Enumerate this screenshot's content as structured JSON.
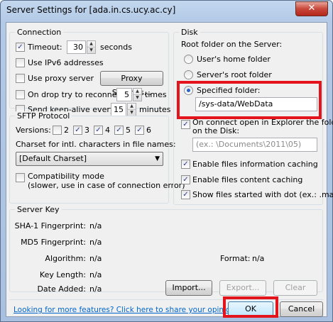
{
  "window": {
    "title": "Server Settings for [ada.in.cs.ucy.ac.cy]",
    "close_glyph": "✕"
  },
  "connection": {
    "title": "Connection",
    "timeout_label": "Timeout:",
    "timeout_value": "30",
    "timeout_unit": "seconds",
    "ipv6_label": "Use IPv6 addresses",
    "proxy_label": "Use proxy server",
    "proxy_button": "Proxy Settings...",
    "reconnect_label": "On drop try to reconnect",
    "reconnect_value": "5",
    "reconnect_unit": "times",
    "keepalive_label": "Send keep-alive every",
    "keepalive_value": "15",
    "keepalive_unit": "minutes"
  },
  "sftp": {
    "title": "SFTP Protocol",
    "versions_label": "Versions:",
    "versions": [
      "2",
      "3",
      "4",
      "5",
      "6"
    ],
    "charset_label": "Charset for intl. characters in file names:",
    "charset_value": "[Default Charset]",
    "compat_line1": "Compatibility mode",
    "compat_line2": "(slower, use in case of connection error)"
  },
  "disk": {
    "title": "Disk",
    "root_label": "Root folder on the Server:",
    "opt_home": "User's home folder",
    "opt_root": "Server's root folder",
    "opt_specified": "Specified folder:",
    "folder_value": "/sys-data/WebData",
    "open_line1": "On connect open in Explorer the folder",
    "open_line2": "on the Disk:",
    "open_placeholder": "(ex.: \\Documents\\2011\\05)",
    "info_cache": "Enable files information caching",
    "content_cache": "Enable files content caching",
    "dotfiles": "Show files started with dot (ex.: .mailrc)"
  },
  "server_key": {
    "title": "Server Key",
    "sha1_label": "SHA-1 Fingerprint:",
    "sha1_value": "n/a",
    "md5_label": "MD5 Fingerprint:",
    "md5_value": "n/a",
    "algo_label": "Algorithm:",
    "algo_value": "n/a",
    "keylen_label": "Key Length:",
    "keylen_value": "n/a",
    "date_label": "Date Added:",
    "date_value": "n/a",
    "format_label": "Format:",
    "format_value": "n/a",
    "import_button": "Import...",
    "export_button": "Export...",
    "clear_button": "Clear"
  },
  "footer": {
    "link": "Looking for more features? Click here to share your opinion.",
    "ok_button": "OK",
    "cancel_button": "Cancel"
  },
  "colors": {
    "highlight_red": "#e3141b",
    "link_blue": "#0066cc"
  }
}
